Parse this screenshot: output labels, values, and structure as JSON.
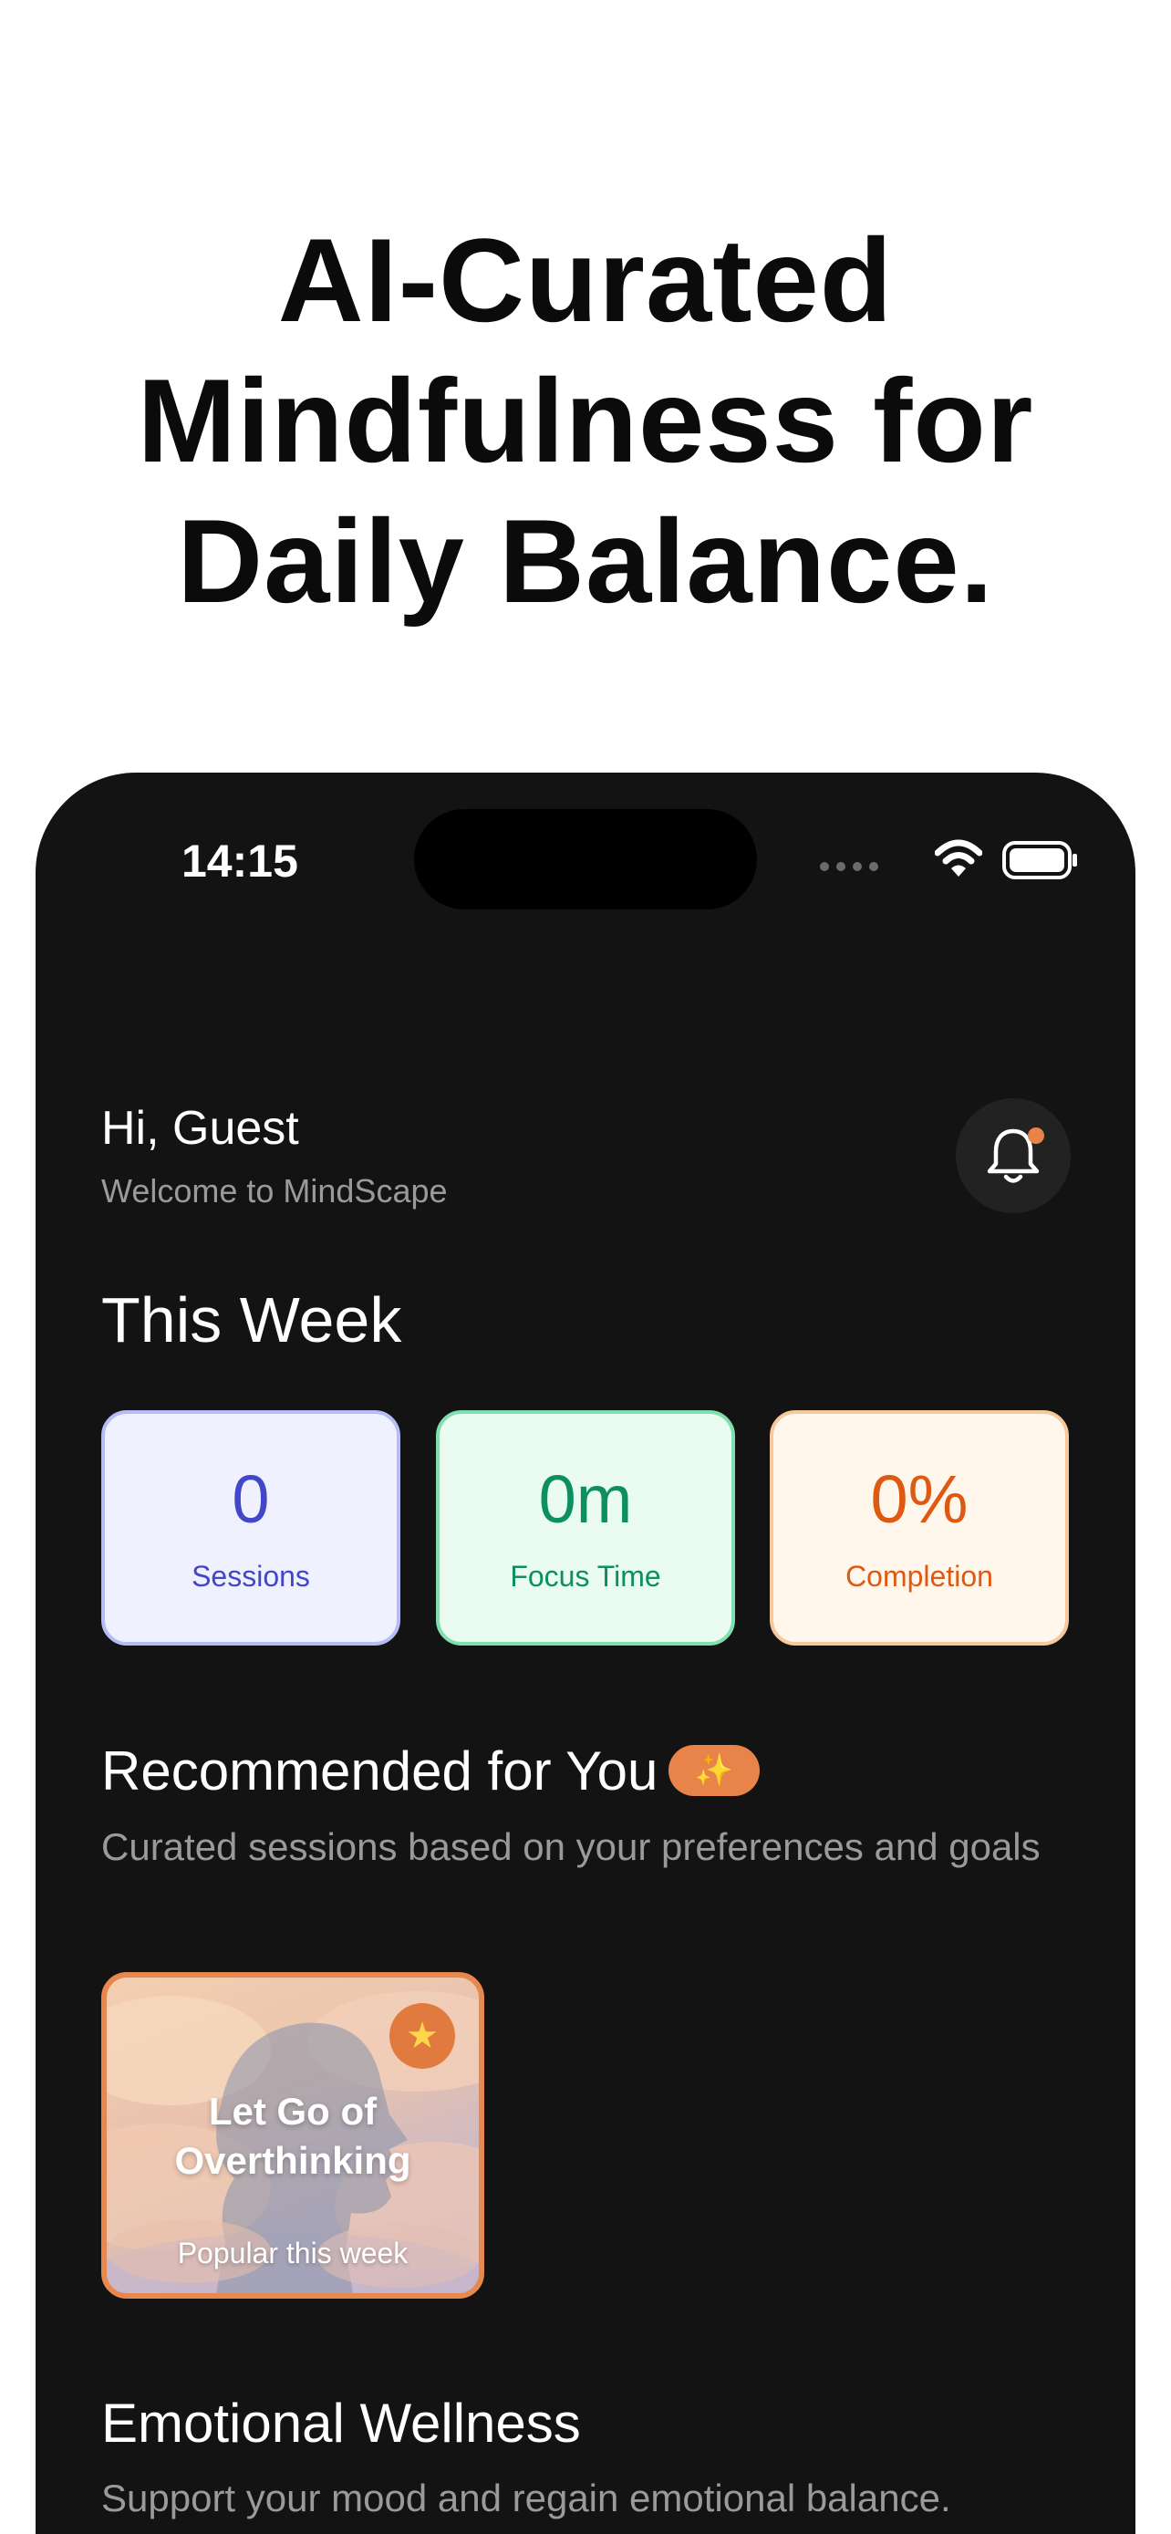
{
  "headline": {
    "lines": [
      "AI-Curated",
      "Mindfulness for",
      "Daily Balance."
    ]
  },
  "status_bar": {
    "time": "14:15",
    "icons": [
      "signal-icon",
      "wifi-icon",
      "battery-icon"
    ]
  },
  "header": {
    "greeting": "Hi, Guest",
    "welcome": "Welcome to MindScape",
    "notification_icon": "bell-icon",
    "has_unread": true
  },
  "this_week": {
    "title": "This Week",
    "stats": [
      {
        "value": "0",
        "label": "Sessions",
        "color": "#4346c8"
      },
      {
        "value": "0m",
        "label": "Focus Time",
        "color": "#0d8f5e"
      },
      {
        "value": "0%",
        "label": "Completion",
        "color": "#de5a12"
      }
    ]
  },
  "recommended": {
    "title": "Recommended for You",
    "badge": "✨",
    "subtitle": "Curated sessions based on your preferences and goals",
    "cards": [
      {
        "title": "Let Go of Overthinking",
        "tag": "Popular this week",
        "badge_icon": "star-icon"
      }
    ]
  },
  "emotional_wellness": {
    "title": "Emotional Wellness",
    "subtitle": "Support your mood and regain emotional balance."
  },
  "colors": {
    "accent": "#e8834a",
    "phone_background": "#131313"
  }
}
